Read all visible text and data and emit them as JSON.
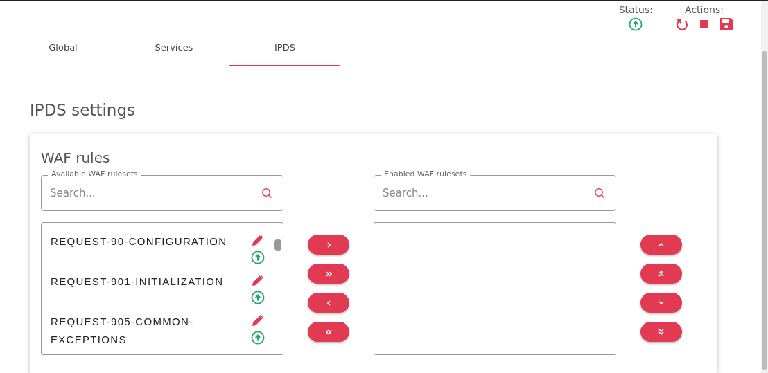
{
  "header": {
    "status_label": "Status:",
    "online": true,
    "actions_label": "Actions:",
    "actions": [
      {
        "kind": "restart"
      },
      {
        "kind": "stop"
      },
      {
        "kind": "save"
      }
    ]
  },
  "tabs": [
    {
      "label": "Global",
      "selected": false
    },
    {
      "label": "Services",
      "selected": false
    },
    {
      "label": "IPDS",
      "selected": true
    }
  ],
  "heading": "IPDS settings",
  "card": {
    "title": "WAF rules",
    "available": {
      "legend": "Available WAF rulesets",
      "placeholder": "Search...",
      "items": [
        {
          "name": "REQUEST-90-CONFIGURATION",
          "online": true
        },
        {
          "name": "REQUEST-901-INITIALIZATION",
          "online": true
        },
        {
          "name": "REQUEST-905-COMMON-EXCEPTIONS",
          "online": true
        }
      ]
    },
    "transfer_buttons": [
      {
        "kind": "right"
      },
      {
        "kind": "all-right"
      },
      {
        "kind": "left"
      },
      {
        "kind": "all-left"
      }
    ],
    "enabled": {
      "legend": "Enabled WAF rulesets",
      "placeholder": "Search..."
    },
    "order_buttons": [
      {
        "kind": "up"
      },
      {
        "kind": "top"
      },
      {
        "kind": "down"
      },
      {
        "kind": "bottom"
      }
    ]
  }
}
